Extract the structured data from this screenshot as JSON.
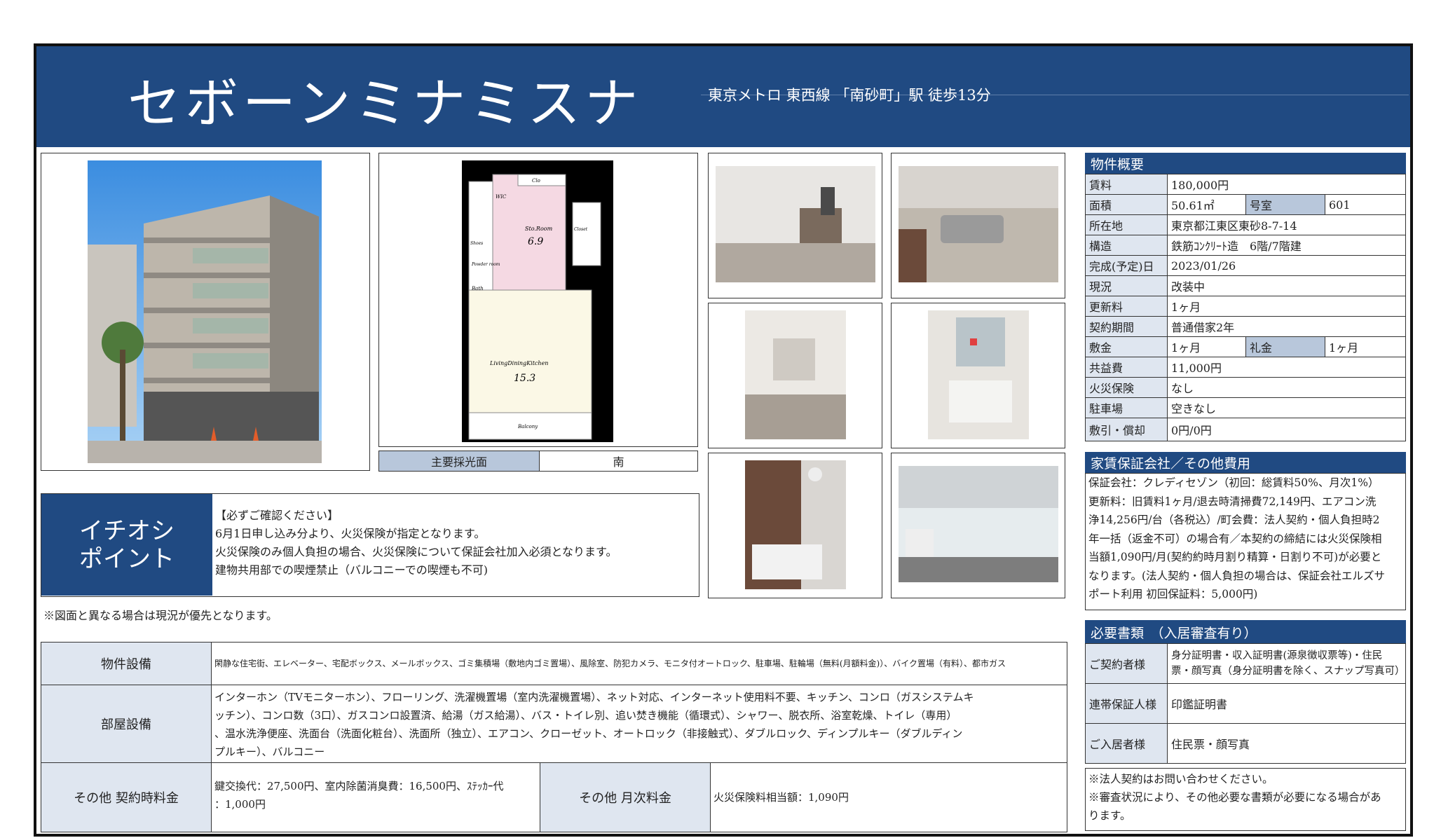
{
  "header": {
    "title": "セボーンミナミスナ",
    "access": "東京メトロ 東西線 「南砂町」駅 徒歩13分"
  },
  "floorplan": {
    "labels": {
      "clo": "Clo",
      "wic": "WIC",
      "shoes": "Shoes",
      "sto_room": "Sto.Room",
      "sto_size": "6.9",
      "closet": "Closet",
      "powder": "Powder room",
      "bath": "Bath",
      "ldk": "LivingDiningKitchen",
      "ldk_size": "15.3",
      "balcony": "Balcony"
    },
    "light_label": "主要採光面",
    "light_value": "南"
  },
  "highlight": {
    "label_line1": "イチオシ",
    "label_line2": "ポイント",
    "lines": [
      "【必ずご確認ください】",
      "6月1日申し込み分より、火災保険が指定となります。",
      "火災保険のみ個人負担の場合、火災保険について保証会社加入必須となります。",
      "建物共用部での喫煙禁止（バルコニーでの喫煙も不可)"
    ]
  },
  "note_floorplan": "※図面と異なる場合は現況が優先となります。",
  "equipment": {
    "building_label": "物件設備",
    "building_value": "閑静な住宅街、エレベーター、宅配ボックス、メールボックス、ゴミ集積場（敷地内ゴミ置場）、風除室、防犯カメラ、モニタ付オートロック、駐車場、駐輪場（無料(月額料金)）、バイク置場（有料）、都市ガス",
    "room_label": "部屋設備",
    "room_lines": [
      "インターホン（TVモニターホン）、フローリング、洗濯機置場（室内洗濯機置場）、ネット対応、インターネット使用料不要、キッチン、コンロ（ガスシステムキ",
      "ッチン）、コンロ数（3口）、ガスコンロ設置済、給湯（ガス給湯）、バス・トイレ別、追い焚き機能（循環式）、シャワー、脱衣所、浴室乾燥、トイレ（専用）",
      "、温水洗浄便座、洗面台（洗面化粧台）、洗面所（独立）、エアコン、クローゼット、オートロック（非接触式）、ダブルロック、ディンプルキー（ダブルディン",
      "プルキー）、バルコニー"
    ],
    "contract_fee_label": "その他 契約時料金",
    "contract_fee_lines": [
      "鍵交換代：27,500円、室内除菌消臭費：16,500円、ｽﾃｯｶｰ代",
      "：1,000円"
    ],
    "monthly_fee_label": "その他 月次料金",
    "monthly_fee_value": "火災保険料相当額：1,090円"
  },
  "summary": {
    "heading": "物件概要",
    "rent_label": "賃料",
    "rent": "180,000円",
    "area_label": "面積",
    "area": "50.61㎡",
    "room_no_label": "号室",
    "room_no": "601",
    "address_label": "所在地",
    "address": "東京都江東区東砂8-7-14",
    "structure_label": "構造",
    "structure": "鉄筋ｺﾝｸﾘｰﾄ造　6階/7階建",
    "built_label": "完成(予定)日",
    "built": "2023/01/26",
    "status_label": "現況",
    "status": "改装中",
    "renewal_label": "更新料",
    "renewal": "1ヶ月",
    "term_label": "契約期間",
    "term": "普通借家2年",
    "deposit_label": "敷金",
    "deposit": "1ヶ月",
    "key_money_label": "礼金",
    "key_money": "1ヶ月",
    "common_fee_label": "共益費",
    "common_fee": "11,000円",
    "fire_ins_label": "火災保険",
    "fire_ins": "なし",
    "parking_label": "駐車場",
    "parking": "空きなし",
    "shikibiki_label": "敷引・償却",
    "shikibiki": "0円/0円"
  },
  "guarantee": {
    "heading": "家賃保証会社／その他費用",
    "lines": [
      "保証会社：クレディセゾン（初回：総賃料50%、月次1%）",
      "更新料：旧賃料1ヶ月/退去時清掃費72,149円、エアコン洗",
      "浄14,256円/台（各税込）/町会費：法人契約・個人負担時2",
      "年一括（返金不可）の場合有／本契約の締結には火災保険相",
      "当額1,090円/月(契約約時月割り精算・日割り不可)が必要と",
      "なります。(法人契約・個人負担の場合は、保証会社エルズサ",
      "ポート利用 初回保証料：5,000円)"
    ]
  },
  "documents": {
    "heading": "必要書類　（入居審査有り）",
    "contractor_label": "ご契約者様",
    "contractor_value": "身分証明書・収入証明書(源泉徴収票等)・住民票・顔写真（身分証明書を除く、スナップ写真可）",
    "guarantor_label": "連帯保証人様",
    "guarantor_value": "印鑑証明書",
    "resident_label": "ご入居者様",
    "resident_value": "住民票・顔写真",
    "notes": [
      "※法人契約はお問い合わせください。",
      "※審査状況により、その他必要な書類が必要になる場合があ",
      "ります。"
    ]
  },
  "colors": {
    "header": "#204a82",
    "label_bg": "#dfe6f0",
    "floor_bg": "#000000"
  }
}
